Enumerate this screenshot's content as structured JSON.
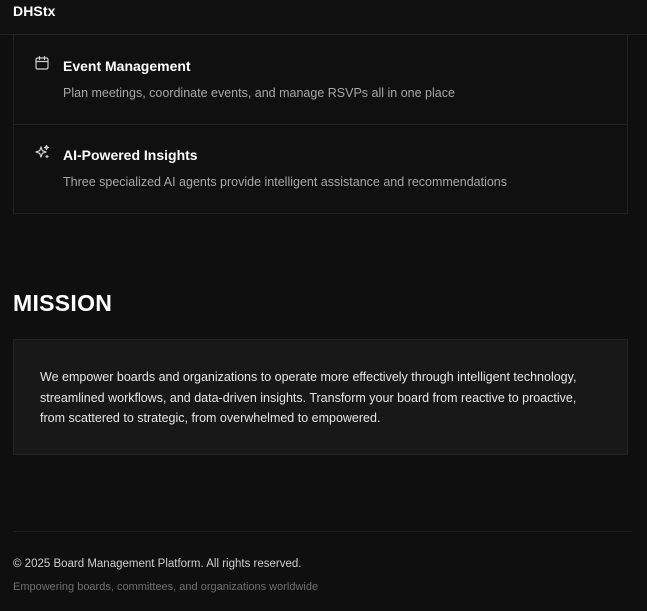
{
  "header": {
    "brand": "DHStx"
  },
  "features": [
    {
      "icon": "calendar-icon",
      "title": "Event Management",
      "description": "Plan meetings, coordinate events, and manage RSVPs all in one place"
    },
    {
      "icon": "sparkles-icon",
      "title": "AI-Powered Insights",
      "description": "Three specialized AI agents provide intelligent assistance and recommendations"
    }
  ],
  "mission": {
    "title": "MISSION",
    "text": "We empower boards and organizations to operate more effectively through intelligent technology, streamlined workflows, and data-driven insights. Transform your board from reactive to proactive, from scattered to strategic, from overwhelmed to empowered."
  },
  "footer": {
    "copyright": "© 2025 Board Management Platform. All rights reserved.",
    "tagline": "Empowering boards, committees, and organizations worldwide"
  },
  "colors": {
    "background": "#0f0f0f",
    "panel": "#181818",
    "border": "#222222",
    "text_primary": "#ffffff",
    "text_muted": "#a7a7a7"
  }
}
